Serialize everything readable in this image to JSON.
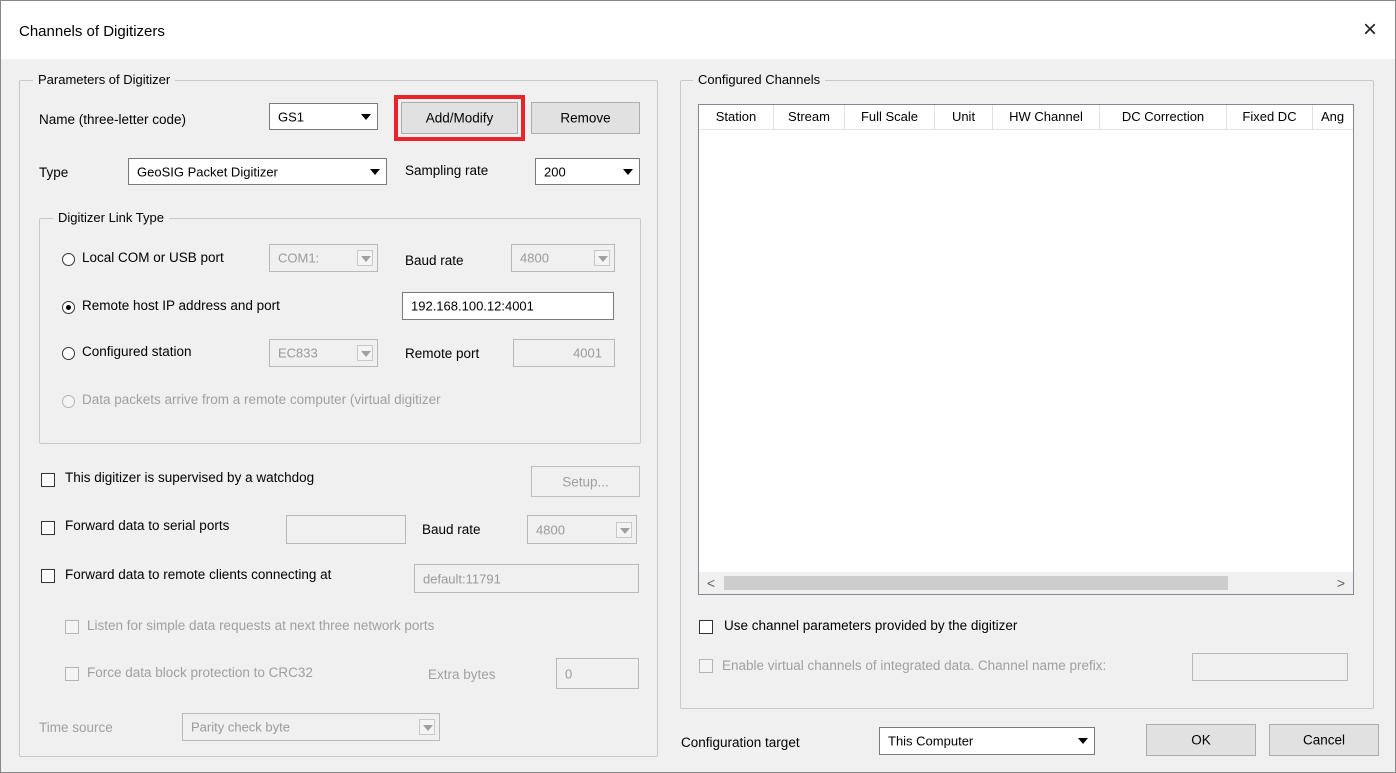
{
  "window": {
    "title": "Channels of Digitizers",
    "close_icon": "×"
  },
  "params": {
    "legend": "Parameters of Digitizer",
    "name_label": "Name (three-letter code)",
    "name_value": "GS1",
    "add_modify": "Add/Modify",
    "remove": "Remove",
    "type_label": "Type",
    "type_value": "GeoSIG Packet Digitizer",
    "sampling_label": "Sampling rate",
    "sampling_value": "200",
    "link": {
      "legend": "Digitizer Link Type",
      "local_com": "Local COM or USB port",
      "com_value": "COM1:",
      "baud_label": "Baud rate",
      "baud_value": "4800",
      "remote_host": "Remote host IP address and port",
      "ip_value": "192.168.100.12:4001",
      "configured_station": "Configured station",
      "station_value": "EC833",
      "remote_port_label": "Remote port",
      "remote_port_value": "4001",
      "virtual": "Data packets arrive from a remote computer (virtual digitizer"
    },
    "watchdog": "This digitizer is supervised by a watchdog",
    "setup": "Setup...",
    "fwd_serial": "Forward data to serial ports",
    "fwd_baud_label": "Baud rate",
    "fwd_baud_value": "4800",
    "fwd_remote": "Forward data to remote clients connecting at",
    "fwd_remote_value": "default:11791",
    "listen": "Listen for simple data requests at next three network ports",
    "crc": "Force data block protection to CRC32",
    "extra_label": "Extra bytes",
    "extra_value": "0",
    "time_label": "Time source",
    "time_value": "Parity check byte"
  },
  "channels": {
    "legend": "Configured Channels",
    "columns": [
      "Station",
      "Stream",
      "Full Scale",
      "Unit",
      "HW Channel",
      "DC Correction",
      "Fixed DC",
      "Ang"
    ],
    "scroll_left": "<",
    "scroll_right": ">",
    "use_params": "Use channel parameters provided by the digitizer",
    "virtual_channels": "Enable virtual channels of integrated data. Channel name prefix:"
  },
  "footer": {
    "target_label": "Configuration target",
    "target_value": "This Computer",
    "ok": "OK",
    "cancel": "Cancel"
  }
}
